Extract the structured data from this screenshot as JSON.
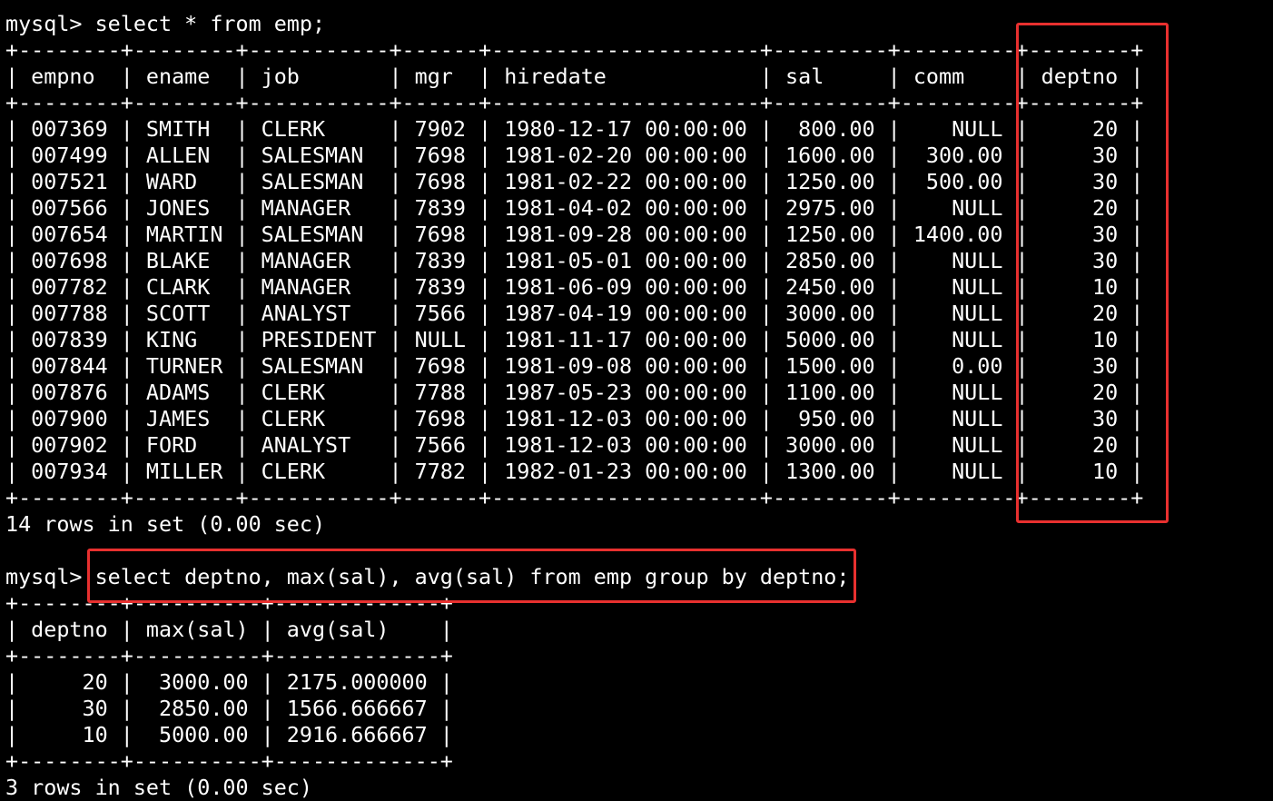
{
  "terminal": {
    "lines": [
      "mysql> select * from emp;",
      "+--------+--------+-----------+------+---------------------+---------+---------+--------+",
      "| empno  | ename  | job       | mgr  | hiredate            | sal     | comm    | deptno |",
      "+--------+--------+-----------+------+---------------------+---------+---------+--------+",
      "| 007369 | SMITH  | CLERK     | 7902 | 1980-12-17 00:00:00 |  800.00 |    NULL |     20 |",
      "| 007499 | ALLEN  | SALESMAN  | 7698 | 1981-02-20 00:00:00 | 1600.00 |  300.00 |     30 |",
      "| 007521 | WARD   | SALESMAN  | 7698 | 1981-02-22 00:00:00 | 1250.00 |  500.00 |     30 |",
      "| 007566 | JONES  | MANAGER   | 7839 | 1981-04-02 00:00:00 | 2975.00 |    NULL |     20 |",
      "| 007654 | MARTIN | SALESMAN  | 7698 | 1981-09-28 00:00:00 | 1250.00 | 1400.00 |     30 |",
      "| 007698 | BLAKE  | MANAGER   | 7839 | 1981-05-01 00:00:00 | 2850.00 |    NULL |     30 |",
      "| 007782 | CLARK  | MANAGER   | 7839 | 1981-06-09 00:00:00 | 2450.00 |    NULL |     10 |",
      "| 007788 | SCOTT  | ANALYST   | 7566 | 1987-04-19 00:00:00 | 3000.00 |    NULL |     20 |",
      "| 007839 | KING   | PRESIDENT | NULL | 1981-11-17 00:00:00 | 5000.00 |    NULL |     10 |",
      "| 007844 | TURNER | SALESMAN  | 7698 | 1981-09-08 00:00:00 | 1500.00 |    0.00 |     30 |",
      "| 007876 | ADAMS  | CLERK     | 7788 | 1987-05-23 00:00:00 | 1100.00 |    NULL |     20 |",
      "| 007900 | JAMES  | CLERK     | 7698 | 1981-12-03 00:00:00 |  950.00 |    NULL |     30 |",
      "| 007902 | FORD   | ANALYST   | 7566 | 1981-12-03 00:00:00 | 3000.00 |    NULL |     20 |",
      "| 007934 | MILLER | CLERK     | 7782 | 1982-01-23 00:00:00 | 1300.00 |    NULL |     10 |",
      "+--------+--------+-----------+------+---------------------+---------+---------+--------+",
      "14 rows in set (0.00 sec)",
      "",
      "mysql> select deptno, max(sal), avg(sal) from emp group by deptno;",
      "+--------+----------+-------------+",
      "| deptno | max(sal) | avg(sal)    |",
      "+--------+----------+-------------+",
      "|     20 |  3000.00 | 2175.000000 |",
      "|     30 |  2850.00 | 1566.666667 |",
      "|     10 |  5000.00 | 2916.666667 |",
      "+--------+----------+-------------+",
      "3 rows in set (0.00 sec)"
    ]
  },
  "colors": {
    "background": "#000000",
    "text": "#ffffff",
    "highlight": "#e8302f"
  }
}
